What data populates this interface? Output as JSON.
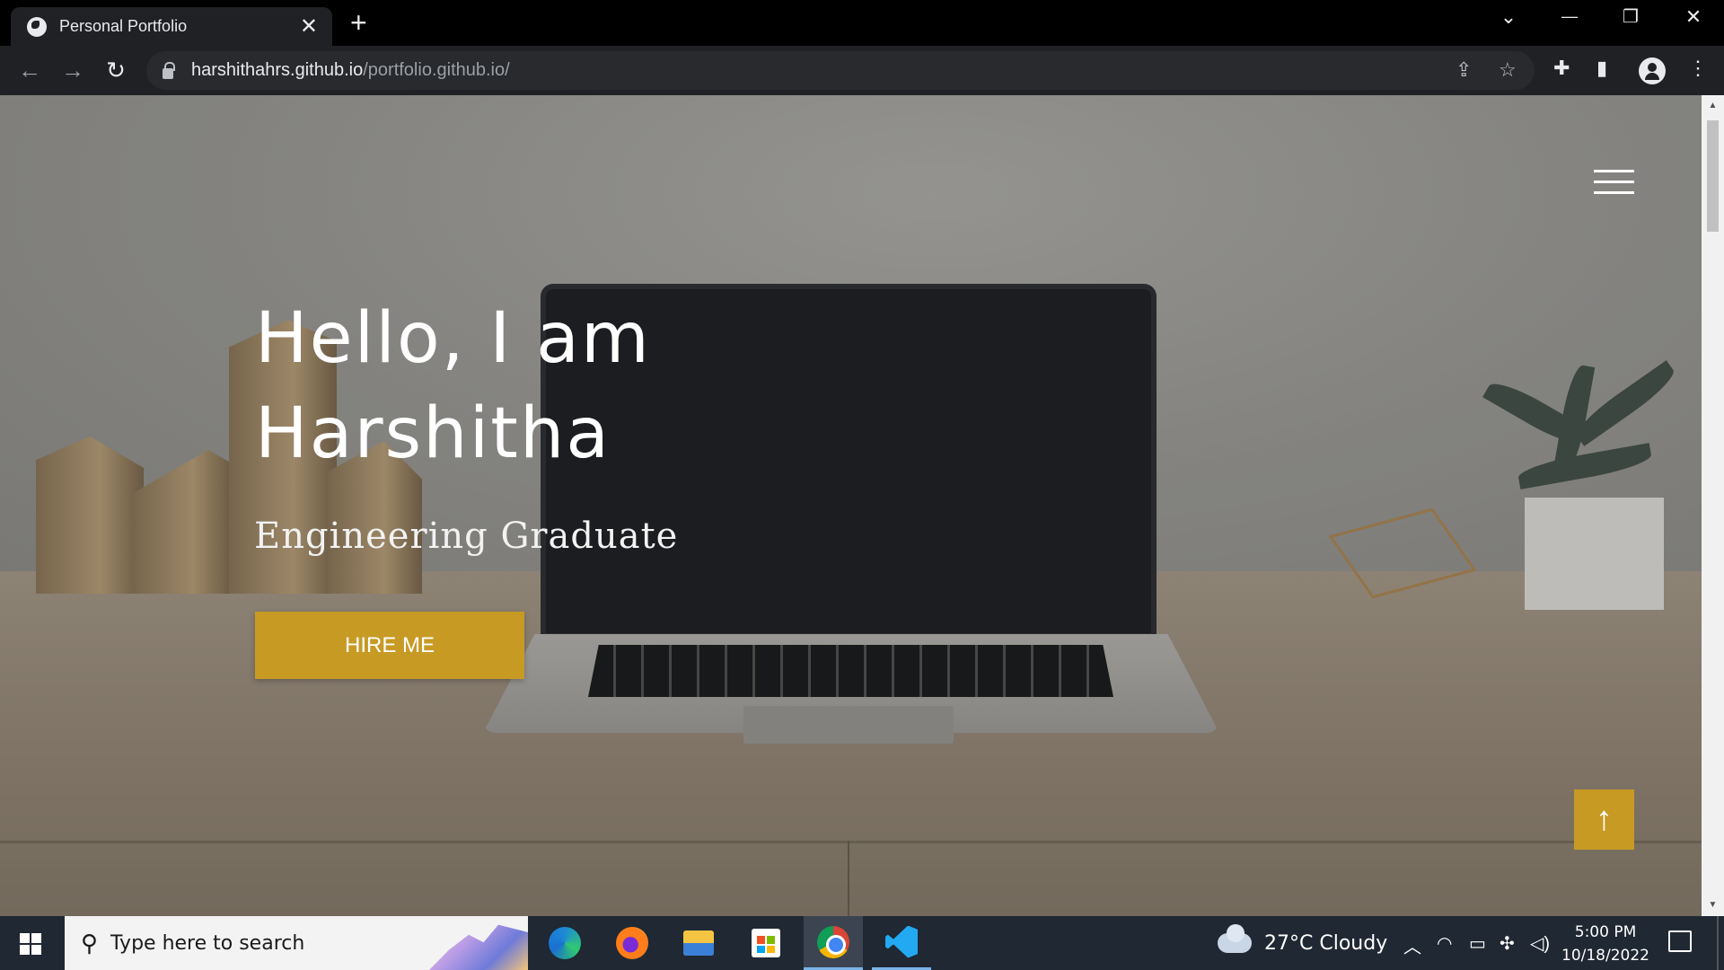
{
  "browser": {
    "tab_title": "Personal Portfolio",
    "tab_close": "✕",
    "new_tab": "+",
    "url_host": "harshithahrs.github.io",
    "url_path": "/portfolio.github.io/",
    "window_controls": {
      "dropdown": "⌄",
      "minimize": "—",
      "restore": "❐",
      "close": "✕"
    },
    "nav": {
      "back": "←",
      "forward": "→",
      "reload": "↻"
    },
    "icons": [
      "share-icon",
      "bookmark-star-icon",
      "extensions-icon",
      "side-panel-icon",
      "profile-icon",
      "menu-dots-icon"
    ]
  },
  "page": {
    "hero_title_line1": "Hello, I am",
    "hero_title_line2": "Harshitha",
    "hero_subtitle": "Engineering Graduate",
    "hire_button": "HIRE ME",
    "back_to_top": "↑",
    "accent_color": "#c79a24"
  },
  "taskbar": {
    "search_placeholder": "Type here to search",
    "apps": [
      "edge",
      "firefox",
      "file-explorer",
      "microsoft-store",
      "chrome",
      "vscode"
    ],
    "weather": "27°C  Cloudy",
    "time": "5:00 PM",
    "date": "10/18/2022"
  }
}
